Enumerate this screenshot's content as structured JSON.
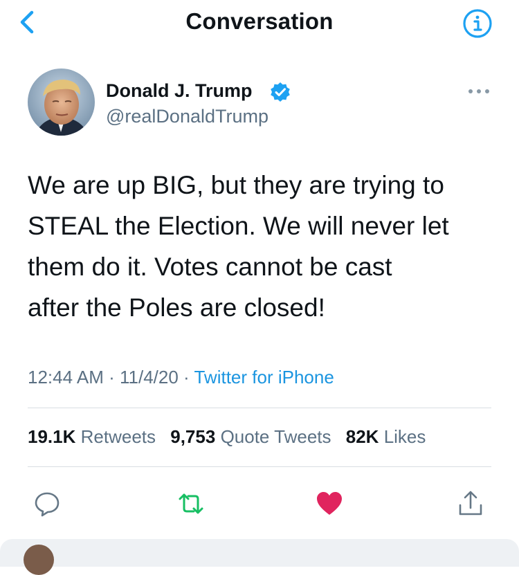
{
  "nav": {
    "title": "Conversation",
    "back_icon": "chevron-left-icon",
    "info_icon": "info-icon",
    "accent_color": "#1da1f2"
  },
  "author": {
    "name": "Donald J. Trump",
    "handle": "@realDonaldTrump",
    "verified": true
  },
  "tweet": {
    "lines": [
      "We are up BIG, but they are trying to",
      "STEAL the Election. We will never let",
      "them do it. Votes cannot be cast",
      "after the Poles are closed!"
    ],
    "time": "12:44 AM",
    "date": "11/4/20",
    "source": "Twitter for iPhone"
  },
  "stats": {
    "retweets_count": "19.1K",
    "retweets_label": "Retweets",
    "quotes_count": "9,753",
    "quotes_label": "Quote Tweets",
    "likes_count": "82K",
    "likes_label": "Likes"
  },
  "actions": {
    "reply_icon": "reply-icon",
    "retweet_icon": "retweet-icon",
    "like_icon": "heart-icon",
    "share_icon": "share-icon",
    "retweet_color": "#17bf63",
    "like_color": "#e0245e"
  }
}
